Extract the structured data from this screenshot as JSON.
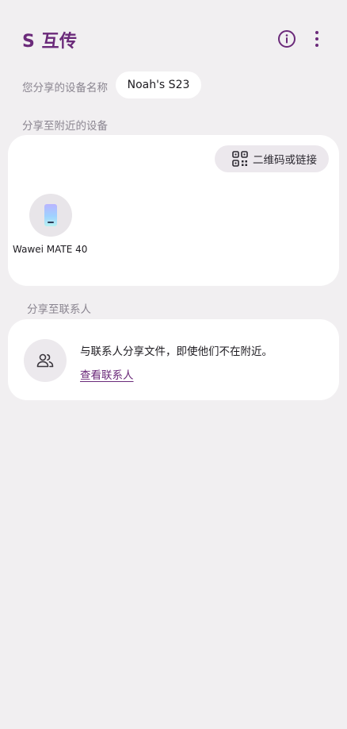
{
  "header": {
    "title": "S 互传",
    "info_icon": "info-icon",
    "more_icon": "more-vert-icon"
  },
  "device_name": {
    "label": "您分享的设备名称",
    "value": "Noah's S23"
  },
  "nearby": {
    "section_title": "分享至附近的设备",
    "qr_button_label": "二维码或链接",
    "qr_icon": "qr-code-icon",
    "devices": [
      {
        "name": "Wawei MATE 40",
        "icon": "phone-icon"
      }
    ]
  },
  "contacts": {
    "section_title": "分享至联系人",
    "icon": "contacts-icon",
    "description": "与联系人分享文件，即使他们不在附近。",
    "link_label": "查看联系人"
  },
  "colors": {
    "background": "#f1eff1",
    "accent": "#6b2a7a",
    "card": "#ffffff",
    "secondary_text": "#8a8590"
  }
}
